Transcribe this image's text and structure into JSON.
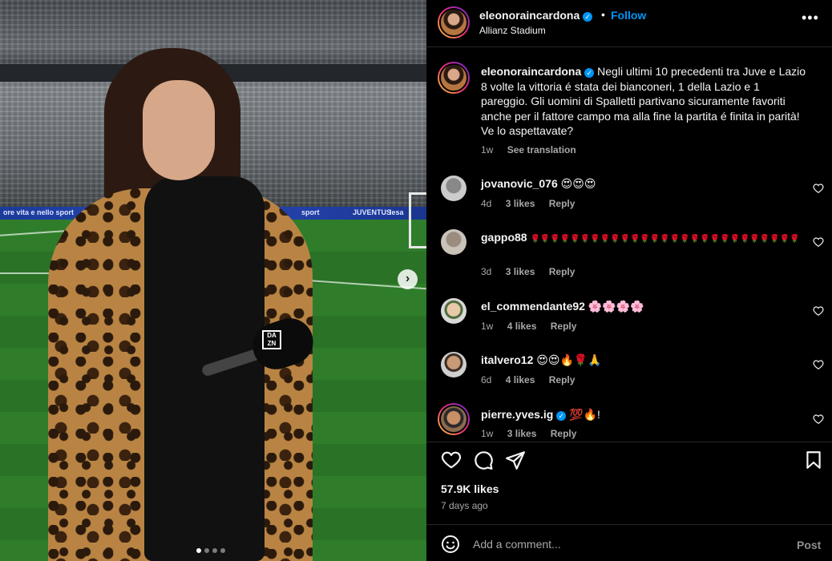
{
  "post": {
    "username": "eleonoraincardona",
    "follow_label": "Follow",
    "separator": "•",
    "location": "Allianz Stadium",
    "more_label": "•••",
    "caption": "Negli ultimi 10 precedenti tra Juve e Lazio 8 volte la vittoria é stata dei bianconeri, 1 della Lazio e 1 pareggio. Gli uomini di Spalletti partivano sicuramente favoriti anche per il fattore campo ma alla fine la partita é finita in parità! Ve lo aspettavate?",
    "caption_age": "1w",
    "see_translation": "See translation",
    "likes": "57.9K likes",
    "posted_ago": "7 days ago",
    "verified_color": "#0095f6",
    "accent_color": "#0095f6"
  },
  "media": {
    "slide_count": 4,
    "active_slide": 1,
    "next_icon": "chevron-right-icon",
    "adboard_texts": [
      "ore vita e nello sport",
      "sport",
      "JUVENTUS",
      "lesa"
    ],
    "mic_logo": "DA ZN"
  },
  "comments": [
    {
      "username": "jovanovic_076",
      "text": "😍😍😍",
      "age": "4d",
      "likes": "3 likes",
      "reply": "Reply",
      "verified": false
    },
    {
      "username": "gappo88",
      "text": "🌹🌹🌹🌹🌹🌹🌹🌹🌹🌹🌹🌹🌹🌹🌹🌹🌹🌹🌹🌹🌹🌹🌹🌹🌹🌹🌹",
      "age": "3d",
      "likes": "3 likes",
      "reply": "Reply",
      "verified": false
    },
    {
      "username": "el_commendante92",
      "text": "🌸🌸🌸🌸",
      "age": "1w",
      "likes": "4 likes",
      "reply": "Reply",
      "verified": false
    },
    {
      "username": "italvero12",
      "text": "😍😍🔥🌹🙏",
      "age": "6d",
      "likes": "4 likes",
      "reply": "Reply",
      "verified": false
    },
    {
      "username": "pierre.yves.ig",
      "text": "💯🔥!",
      "age": "1w",
      "likes": "3 likes",
      "reply": "Reply",
      "verified": true
    }
  ],
  "actions": {
    "like_icon": "heart-icon",
    "comment_icon": "comment-icon",
    "share_icon": "send-icon",
    "save_icon": "bookmark-icon"
  },
  "composer": {
    "placeholder": "Add a comment...",
    "post_label": "Post",
    "emoji_icon": "emoji-icon"
  }
}
